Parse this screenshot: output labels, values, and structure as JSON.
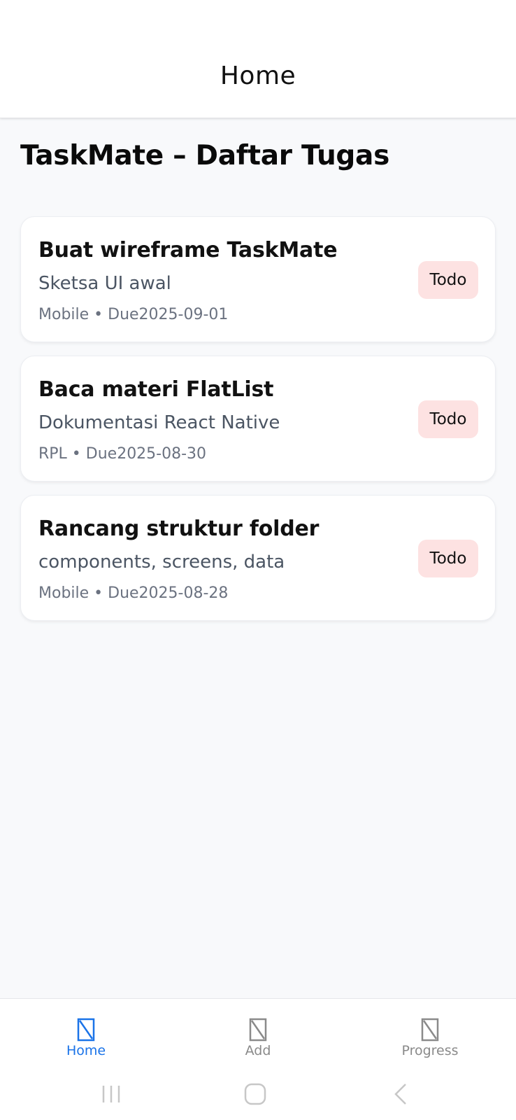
{
  "header": {
    "title": "Home"
  },
  "page": {
    "title": "TaskMate – Daftar Tugas"
  },
  "tasks": [
    {
      "title": "Buat wireframe TaskMate",
      "description": "Sketsa UI awal",
      "meta": "Mobile • Due2025-09-01",
      "status": "Todo"
    },
    {
      "title": "Baca materi FlatList",
      "description": "Dokumentasi React Native",
      "meta": "RPL • Due2025-08-30",
      "status": "Todo"
    },
    {
      "title": "Rancang struktur folder",
      "description": "components, screens, data",
      "meta": "Mobile • Due2025-08-28",
      "status": "Todo"
    }
  ],
  "tabbar": {
    "items": [
      {
        "label": "Home",
        "icon": "placeholder-icon",
        "active": true
      },
      {
        "label": "Add",
        "icon": "placeholder-icon",
        "active": false
      },
      {
        "label": "Progress",
        "icon": "placeholder-icon",
        "active": false
      }
    ]
  },
  "colors": {
    "accent": "#1a73e8",
    "badge_bg": "#fde2e2",
    "background": "#f8f9fb",
    "inactive": "#8a8a8a"
  }
}
